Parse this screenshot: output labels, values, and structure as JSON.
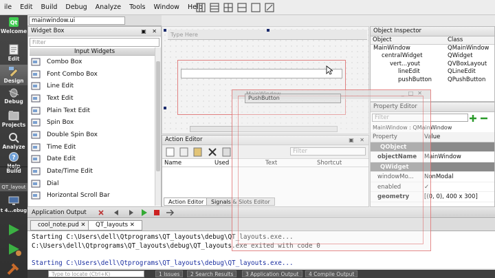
{
  "menubar": {
    "items": [
      {
        "label": "ile",
        "mnemonic": ""
      },
      {
        "label": "Edit"
      },
      {
        "label": "Build"
      },
      {
        "label": "Debug"
      },
      {
        "label": "Analyze"
      },
      {
        "label": "Tools"
      },
      {
        "label": "Window"
      },
      {
        "label": "Help"
      }
    ]
  },
  "modebar": {
    "modes": [
      {
        "label": "Welcome",
        "icon": "qt-logo-icon"
      },
      {
        "label": "Edit",
        "icon": "edit-icon"
      },
      {
        "label": "Design",
        "icon": "design-icon",
        "active": true
      },
      {
        "label": "Debug",
        "icon": "debug-icon"
      },
      {
        "label": "Projects",
        "icon": "projects-icon"
      },
      {
        "label": "Analyze",
        "icon": "analyze-icon"
      },
      {
        "label": "Help",
        "icon": "help-icon"
      }
    ],
    "build_label": "Build",
    "target_project": "QT_layout",
    "target_config": "t 4...ebug"
  },
  "document": {
    "file_combo": "mainwindow.ui",
    "type_here": "Type Here"
  },
  "widget_box": {
    "title": "Widget Box",
    "filter_placeholder": "Filter",
    "category": "Input Widgets",
    "items": [
      {
        "label": "Combo Box",
        "icon": "combo-box-icon"
      },
      {
        "label": "Font Combo Box",
        "icon": "font-combo-box-icon"
      },
      {
        "label": "Line Edit",
        "icon": "line-edit-icon"
      },
      {
        "label": "Text Edit",
        "icon": "text-edit-icon"
      },
      {
        "label": "Plain Text Edit",
        "icon": "plain-text-edit-icon"
      },
      {
        "label": "Spin Box",
        "icon": "spin-box-icon"
      },
      {
        "label": "Double Spin Box",
        "icon": "double-spin-box-icon"
      },
      {
        "label": "Time Edit",
        "icon": "time-edit-icon"
      },
      {
        "label": "Date Edit",
        "icon": "date-edit-icon"
      },
      {
        "label": "Date/Time Edit",
        "icon": "date-time-edit-icon"
      },
      {
        "label": "Dial",
        "icon": "dial-icon"
      },
      {
        "label": "Horizontal Scroll Bar",
        "icon": "horizontal-scroll-bar-icon"
      }
    ]
  },
  "object_inspector": {
    "title": "Object Inspector",
    "col_object": "Object",
    "col_class": "Class",
    "rows": [
      {
        "object": "MainWindow",
        "class": "QMainWindow",
        "indent": 0
      },
      {
        "object": "centralWidget",
        "class": "QWidget",
        "indent": 1
      },
      {
        "object": "vert...yout",
        "class": "QVBoxLayout",
        "indent": 2
      },
      {
        "object": "lineEdit",
        "class": "QLineEdit",
        "indent": 3
      },
      {
        "object": "pushButton",
        "class": "QPushButton",
        "indent": 3
      }
    ]
  },
  "property_editor": {
    "title": "Property Editor",
    "filter_placeholder": "Filter",
    "context": "MainWindow : QMainWindow",
    "col_property": "Property",
    "col_value": "Value",
    "rows": [
      {
        "property": "QObject",
        "value": "",
        "group": true
      },
      {
        "property": "objectName",
        "value": "MainWindow",
        "bold": true
      },
      {
        "property": "QWidget",
        "value": "",
        "group": true
      },
      {
        "property": "windowMo...",
        "value": "NonModal"
      },
      {
        "property": "enabled",
        "value": "✓"
      },
      {
        "property": "geometry",
        "value": "[(0, 0), 400 x 300]",
        "bold": true
      }
    ]
  },
  "action_editor": {
    "title": "Action Editor",
    "filter_placeholder": "Filter",
    "columns": [
      "Name",
      "Used",
      "Text",
      "Shortcut"
    ],
    "tabs": [
      "Action Editor",
      "Signals & Slots Editor"
    ]
  },
  "app_output": {
    "title": "Application Output",
    "tabs": [
      "cool_note.pud",
      "QT_layouts"
    ],
    "lines": [
      {
        "text": "Starting C:\\Users\\dell\\Qtprograms\\QT_layouts\\debug\\QT_layouts.exe...",
        "color": "#111111"
      },
      {
        "text": "C:\\Users\\dell\\Qtprograms\\QT_layouts\\debug\\QT_layouts.exe exited with code 0",
        "color": "#111111"
      },
      {
        "text": "",
        "color": "#111111"
      },
      {
        "text": "Starting C:\\Users\\dell\\Qtprograms\\QT_layouts\\debug\\QT_layouts.exe...",
        "color": "#1b2fa0"
      }
    ]
  },
  "preview": {
    "title": "MainWindow",
    "button_label": "PushButton"
  },
  "statusbar": {
    "locator_placeholder": "Type to locate (Ctrl+K)",
    "items": [
      "1 Issues",
      "2 Search Results",
      "3 Application Output",
      "4 Compile Output"
    ]
  }
}
